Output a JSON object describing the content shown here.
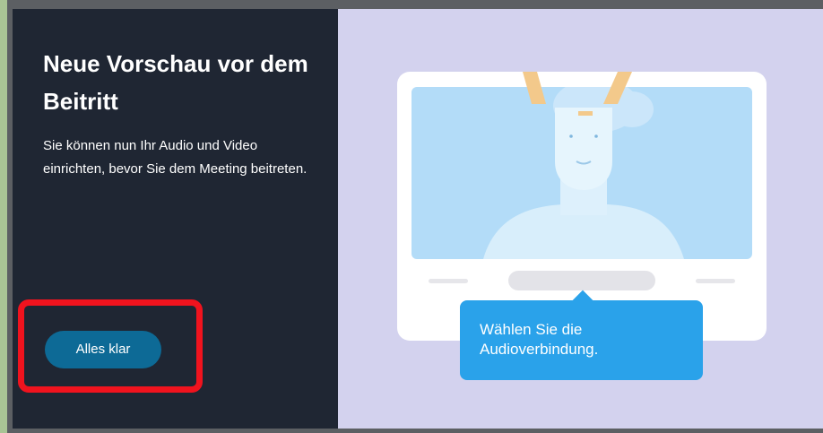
{
  "dialog": {
    "title": "Neue Vorschau vor dem Beitritt",
    "description": "Sie können nun Ihr Audio und Video einrichten, bevor Sie dem Meeting beitreten.",
    "primary_button_label": "Alles klar"
  },
  "illustration": {
    "tooltip_text": "Wählen Sie die Audioverbindung."
  },
  "colors": {
    "left_panel": "#1f2633",
    "right_panel": "#d3d2ee",
    "button": "#0d6a96",
    "tooltip": "#2aa2ea",
    "highlight": "#f0131e"
  }
}
